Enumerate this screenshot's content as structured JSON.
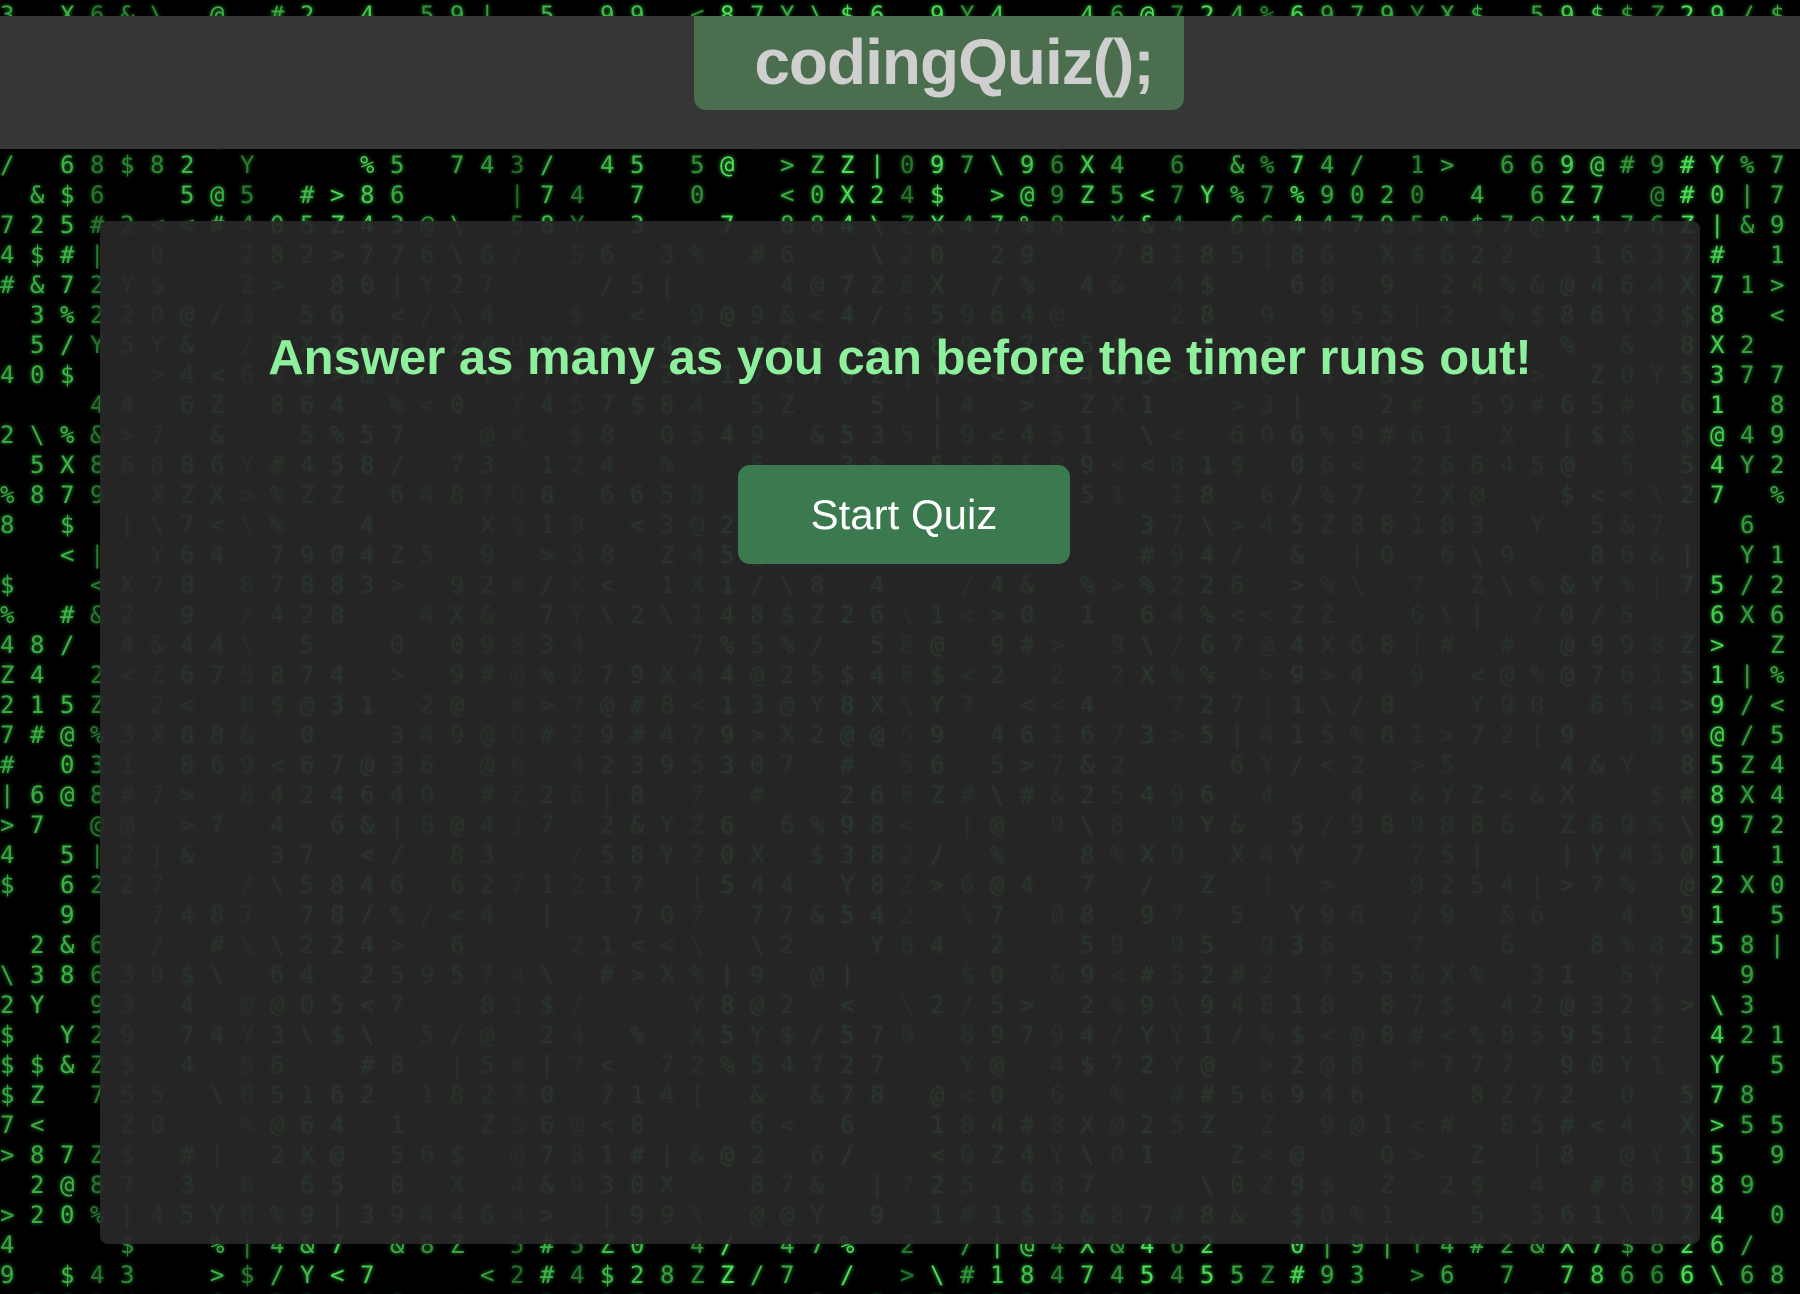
{
  "header": {
    "title": "codingQuiz();"
  },
  "main": {
    "prompt": "Answer as many as you can before the timer runs out!",
    "start_button_label": "Start Quiz"
  },
  "colors": {
    "page_background": "#000000",
    "header_background": "#363636",
    "title_box_background": "#4b6f4e",
    "title_text": "#cfcfcf",
    "card_background": "#282828",
    "prompt_text": "#8ef09c",
    "button_background": "#3b7a4f",
    "button_text": "#ffffff",
    "matrix_glyph": "#4fe85a"
  }
}
